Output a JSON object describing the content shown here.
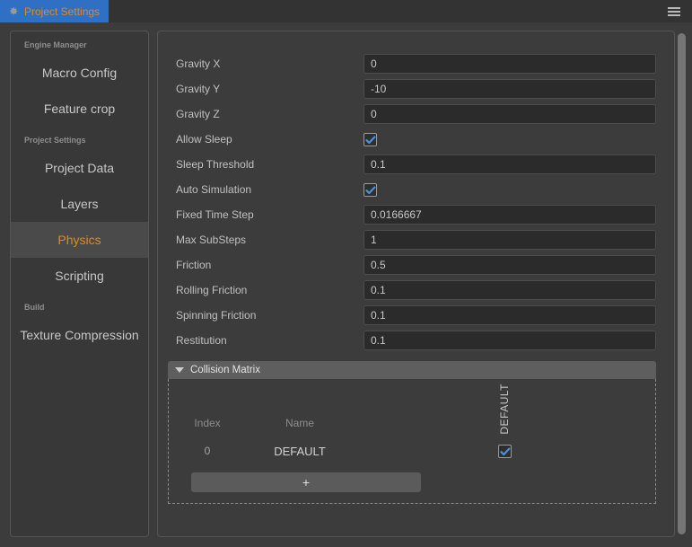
{
  "titlebar": {
    "tab_label": "Project Settings",
    "gear_icon": "gear-icon",
    "menu_icon": "hamburger-menu-icon"
  },
  "sidebar": {
    "groups": [
      {
        "title": "Engine Manager",
        "items": [
          {
            "label": "Macro Config",
            "selected": false
          },
          {
            "label": "Feature crop",
            "selected": false
          }
        ]
      },
      {
        "title": "Project Settings",
        "items": [
          {
            "label": "Project Data",
            "selected": false
          },
          {
            "label": "Layers",
            "selected": false
          },
          {
            "label": "Physics",
            "selected": true
          },
          {
            "label": "Scripting",
            "selected": false
          }
        ]
      },
      {
        "title": "Build",
        "items": [
          {
            "label": "Texture Compression",
            "selected": false
          }
        ]
      }
    ]
  },
  "form": {
    "rows": [
      {
        "label": "Gravity X",
        "type": "text",
        "value": "0"
      },
      {
        "label": "Gravity Y",
        "type": "text",
        "value": "-10"
      },
      {
        "label": "Gravity Z",
        "type": "text",
        "value": "0"
      },
      {
        "label": "Allow Sleep",
        "type": "checkbox",
        "checked": true
      },
      {
        "label": "Sleep Threshold",
        "type": "text",
        "value": "0.1"
      },
      {
        "label": "Auto Simulation",
        "type": "checkbox",
        "checked": true
      },
      {
        "label": "Fixed Time Step",
        "type": "text",
        "value": "0.0166667"
      },
      {
        "label": "Max SubSteps",
        "type": "text",
        "value": "1"
      },
      {
        "label": "Friction",
        "type": "text",
        "value": "0.5"
      },
      {
        "label": "Rolling Friction",
        "type": "text",
        "value": "0.1"
      },
      {
        "label": "Spinning Friction",
        "type": "text",
        "value": "0.1"
      },
      {
        "label": "Restitution",
        "type": "text",
        "value": "0.1"
      }
    ]
  },
  "collision_matrix": {
    "title": "Collision Matrix",
    "expanded": true,
    "columns": {
      "index": "Index",
      "name": "Name"
    },
    "matrix_columns": [
      "DEFAULT"
    ],
    "rows": [
      {
        "index": "0",
        "name": "DEFAULT",
        "checks": [
          true
        ]
      }
    ],
    "add_button_label": "+"
  },
  "colors": {
    "accent_orange": "#e08a1e",
    "tab_blue": "#2f6fc4",
    "checkbox_blue": "#4a90e2",
    "panel_bg": "#3c3c3c",
    "sidebar_bg": "#383838",
    "field_bg": "#2b2b2b"
  }
}
